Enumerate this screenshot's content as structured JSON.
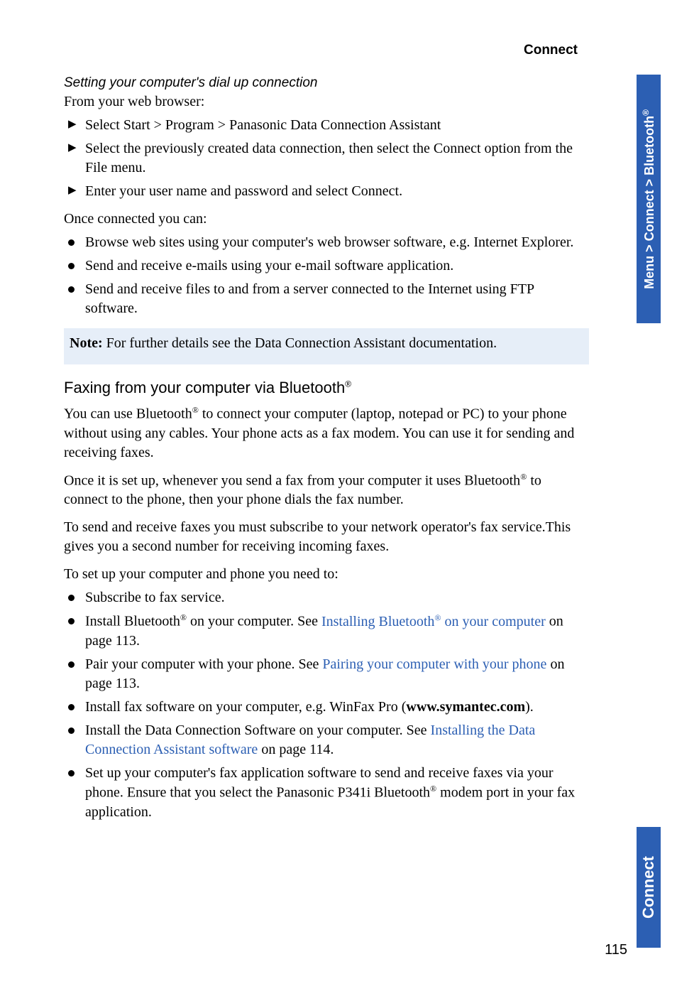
{
  "header": {
    "section_title": "Connect"
  },
  "sidebar": {
    "top": "Menu > Connect > Bluetooth",
    "top_reg": "®",
    "bottom": "Connect"
  },
  "content": {
    "sub1_title": "Setting your computer's dial up connection",
    "sub1_intro": "From your web browser:",
    "arrow_items": [
      "Select Start > Program > Panasonic Data Connection Assistant",
      "Select the previously created data connection, then select the Connect option from the File menu.",
      "Enter your user name and password and select Connect."
    ],
    "once_connected": "Once connected you can:",
    "connected_bullets": [
      "Browse web sites using your computer's web browser software, e.g. Internet Explorer.",
      "Send and receive e-mails using your e-mail software application.",
      "Send and receive files to and from a server connected to the Internet using FTP software."
    ],
    "note_label": "Note:",
    "note_text": " For further details see the Data Connection Assistant documentation.",
    "section2_title_pre": "Faxing from your computer via Bluetooth",
    "section2_title_reg": "®",
    "p1_a": "You can use Bluetooth",
    "p1_b": " to connect your computer (laptop, notepad or PC) to your phone without using any cables. Your phone acts as a fax modem. You can use it for sending and receiving faxes.",
    "p2_a": "Once it is set up, whenever you send a fax from your computer it uses Bluetooth",
    "p2_b": " to connect to the phone, then your phone dials the fax number.",
    "p3": "To send and receive faxes you must subscribe to your network operator's fax service.This gives you a second number for receiving incoming faxes.",
    "p4": "To set up your computer and phone you need to:",
    "setup_bullets": {
      "b1": "Subscribe to fax service.",
      "b2_a": "Install Bluetooth",
      "b2_b": " on your computer. See ",
      "b2_link1": "Installing Bluetooth",
      "b2_c": " on your computer",
      "b2_d": " on page 113.",
      "b3_a": "Pair your computer with your phone. See ",
      "b3_link": "Pairing your computer with your phone",
      "b3_b": " on page 113.",
      "b4_a": "Install fax software on your computer, e.g. WinFax Pro (",
      "b4_bold": "www.symantec.com",
      "b4_b": ").",
      "b5_a": "Install the Data Connection Software on your computer. See ",
      "b5_link": "Installing the Data Connection Assistant software",
      "b5_b": " on page 114.",
      "b6_a": "Set up your computer's fax application software to send and receive faxes via your phone. Ensure that you select the Panasonic P341i Bluetooth",
      "b6_b": " modem port in your fax application."
    }
  },
  "page_number": "115",
  "reg_symbol": "®"
}
